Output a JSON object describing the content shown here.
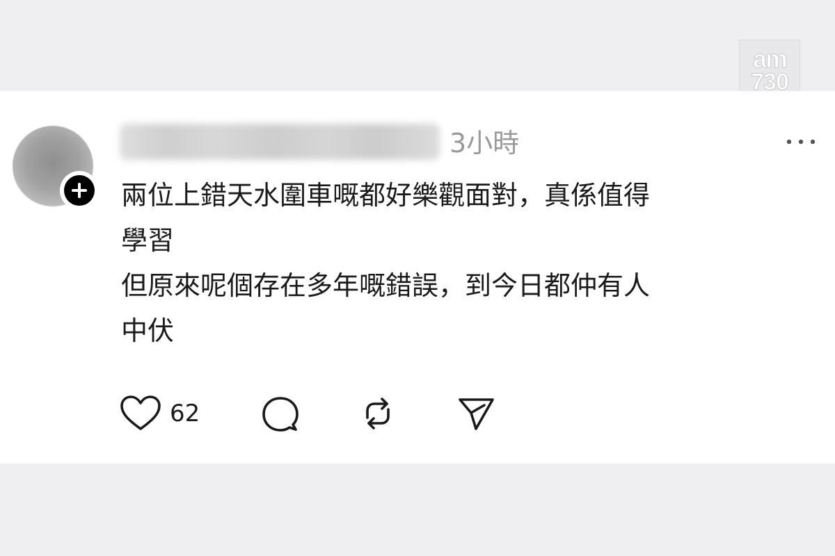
{
  "watermark": {
    "line1": "am",
    "line2": "730"
  },
  "post": {
    "timestamp": "3小時",
    "lines": [
      "兩位上錯天水圍車嘅都好樂觀面對，真係值得",
      "學習",
      "但原來呢個存在多年嘅錯誤，到今日都仲有人",
      "中伏"
    ],
    "like_count": "62"
  },
  "icons": {
    "follow": "plus-icon",
    "more": "more-options-icon",
    "like": "heart-icon",
    "reply": "comment-icon",
    "repost": "repost-icon",
    "share": "send-icon"
  },
  "colors": {
    "page_background": "#efeff2",
    "card_background": "#ffffff",
    "text": "#1a1a1a",
    "muted_text": "#9a9a9a"
  }
}
